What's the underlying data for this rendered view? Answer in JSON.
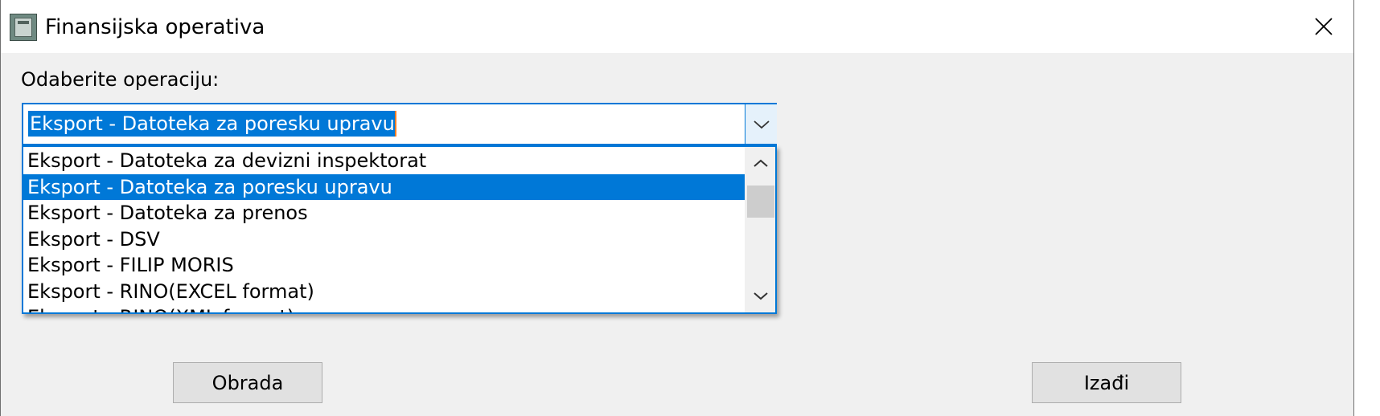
{
  "window": {
    "title": "Finansijska operativa"
  },
  "form": {
    "label": "Odaberite operaciju:",
    "combo_value": "Eksport - Datoteka za poresku upravu"
  },
  "dropdown": {
    "items": [
      "Eksport - Datoteka za devizni inspektorat",
      "Eksport - Datoteka za poresku upravu",
      "Eksport - Datoteka za prenos",
      "Eksport - DSV",
      "Eksport - FILIP MORIS",
      "Eksport - RINO(EXCEL format)",
      "Eksport - RINO(XML format)"
    ],
    "selected_index": 1
  },
  "buttons": {
    "process_label": "Obrada",
    "exit_label": "Izađi"
  },
  "colors": {
    "accent": "#0078d7",
    "caret": "#ff7f27",
    "dialog_bg": "#f0f0f0"
  }
}
